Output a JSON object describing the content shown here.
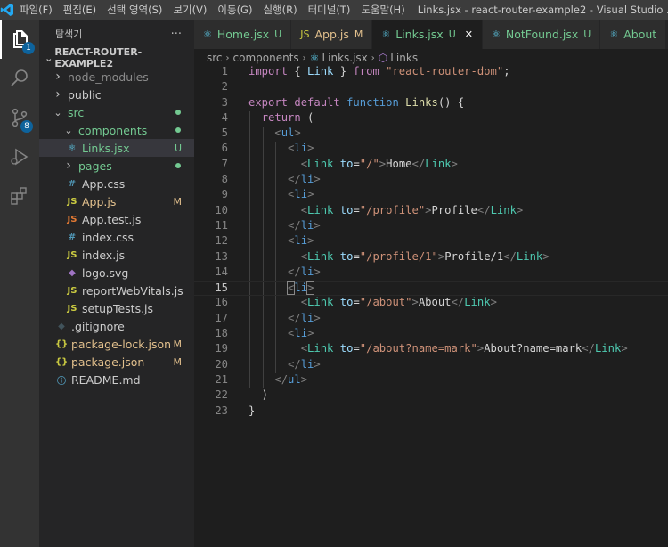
{
  "titlebar": {
    "menu": [
      "파일(F)",
      "편집(E)",
      "선택 영역(S)",
      "보기(V)",
      "이동(G)",
      "실행(R)",
      "터미널(T)",
      "도움말(H)"
    ],
    "title": "Links.jsx - react-router-example2 - Visual Studio ..."
  },
  "activity": {
    "explorer_badge": "1",
    "scm_badge": "8"
  },
  "sidebar": {
    "title": "탐색기",
    "more": "···",
    "project": "REACT-ROUTER-EXAMPLE2",
    "items": [
      {
        "name": "node_modules",
        "kind": "folder-closed",
        "color": "#8b8b8b",
        "badge": "",
        "dot": false
      },
      {
        "name": "public",
        "kind": "folder-closed",
        "color": "#cccccc",
        "badge": "",
        "dot": false
      },
      {
        "name": "src",
        "kind": "folder-open",
        "color": "#73c991",
        "badge": "",
        "dot": true
      },
      {
        "name": "components",
        "kind": "folder-open",
        "color": "#73c991",
        "badge": "",
        "dot": true
      },
      {
        "name": "Links.jsx",
        "kind": "file",
        "icon": "⚛",
        "icon_color": "#61dafb",
        "color": "#73c991",
        "badge": "U",
        "badge_color": "#73c991",
        "dot": false
      },
      {
        "name": "pages",
        "kind": "folder-closed",
        "color": "#73c991",
        "badge": "",
        "dot": true
      },
      {
        "name": "App.css",
        "kind": "file",
        "icon": "#",
        "icon_color": "#519aba",
        "color": "#cccccc",
        "badge": "",
        "dot": false
      },
      {
        "name": "App.js",
        "kind": "file",
        "icon": "JS",
        "icon_color": "#cbcb41",
        "color": "#e2c08d",
        "badge": "M",
        "badge_color": "#e2c08d",
        "dot": false
      },
      {
        "name": "App.test.js",
        "kind": "file",
        "icon": "JS",
        "icon_color": "#e37933",
        "color": "#cccccc",
        "badge": "",
        "dot": false
      },
      {
        "name": "index.css",
        "kind": "file",
        "icon": "#",
        "icon_color": "#519aba",
        "color": "#cccccc",
        "badge": "",
        "dot": false
      },
      {
        "name": "index.js",
        "kind": "file",
        "icon": "JS",
        "icon_color": "#cbcb41",
        "color": "#cccccc",
        "badge": "",
        "dot": false
      },
      {
        "name": "logo.svg",
        "kind": "file",
        "icon": "◆",
        "icon_color": "#a074c4",
        "color": "#cccccc",
        "badge": "",
        "dot": false
      },
      {
        "name": "reportWebVitals.js",
        "kind": "file",
        "icon": "JS",
        "icon_color": "#cbcb41",
        "color": "#cccccc",
        "badge": "",
        "dot": false
      },
      {
        "name": "setupTests.js",
        "kind": "file",
        "icon": "JS",
        "icon_color": "#cbcb41",
        "color": "#cccccc",
        "badge": "",
        "dot": false
      },
      {
        "name": ".gitignore",
        "kind": "file",
        "icon": "◆",
        "icon_color": "#41535b",
        "color": "#cccccc",
        "badge": "",
        "dot": false
      },
      {
        "name": "package-lock.json",
        "kind": "file",
        "icon": "{}",
        "icon_color": "#cbcb41",
        "color": "#e2c08d",
        "badge": "M",
        "badge_color": "#e2c08d",
        "dot": false
      },
      {
        "name": "package.json",
        "kind": "file",
        "icon": "{}",
        "icon_color": "#cbcb41",
        "color": "#e2c08d",
        "badge": "M",
        "badge_color": "#e2c08d",
        "dot": false
      },
      {
        "name": "README.md",
        "kind": "file",
        "icon": "ⓘ",
        "icon_color": "#519aba",
        "color": "#cccccc",
        "badge": "",
        "dot": false
      }
    ]
  },
  "tabs": [
    {
      "label": "Home.jsx",
      "icon": "⚛",
      "icon_color": "#61dafb",
      "status": "U",
      "color": "#73c991",
      "active": false
    },
    {
      "label": "App.js",
      "icon": "JS",
      "icon_color": "#cbcb41",
      "status": "M",
      "color": "#e2c08d",
      "active": false
    },
    {
      "label": "Links.jsx",
      "icon": "⚛",
      "icon_color": "#61dafb",
      "status": "U",
      "color": "#73c991",
      "active": true,
      "close": "✕"
    },
    {
      "label": "NotFound.jsx",
      "icon": "⚛",
      "icon_color": "#61dafb",
      "status": "U",
      "color": "#73c991",
      "active": false
    },
    {
      "label": "About",
      "icon": "⚛",
      "icon_color": "#61dafb",
      "status": "",
      "color": "#73c991",
      "active": false
    }
  ],
  "breadcrumb": [
    "src",
    "components",
    "Links.jsx",
    "Links"
  ],
  "editor": {
    "current_line": 15,
    "lines": [
      [
        [
          "kw",
          "import"
        ],
        [
          "tx",
          " { "
        ],
        [
          "id",
          "Link"
        ],
        [
          "tx",
          " } "
        ],
        [
          "kw",
          "from"
        ],
        [
          "tx",
          " "
        ],
        [
          "str",
          "\"react-router-dom\""
        ],
        [
          "tx",
          ";"
        ]
      ],
      [],
      [
        [
          "kw",
          "export"
        ],
        [
          "tx",
          " "
        ],
        [
          "kw",
          "default"
        ],
        [
          "tx",
          " "
        ],
        [
          "bl",
          "function"
        ],
        [
          "tx",
          " "
        ],
        [
          "fn",
          "Links"
        ],
        [
          "tx",
          "() {"
        ]
      ],
      [
        [
          "tx",
          "  "
        ],
        [
          "kw",
          "return"
        ],
        [
          "tx",
          " ("
        ]
      ],
      [
        [
          "tx",
          "    "
        ],
        [
          "tag",
          "<"
        ],
        [
          "tn",
          "ul"
        ],
        [
          "tag",
          ">"
        ]
      ],
      [
        [
          "tx",
          "      "
        ],
        [
          "tag",
          "<"
        ],
        [
          "tn",
          "li"
        ],
        [
          "tag",
          ">"
        ]
      ],
      [
        [
          "tx",
          "        "
        ],
        [
          "tag",
          "<"
        ],
        [
          "comp",
          "Link"
        ],
        [
          "tx",
          " "
        ],
        [
          "at",
          "to"
        ],
        [
          "tx",
          "="
        ],
        [
          "str",
          "\"/\""
        ],
        [
          "tag",
          ">"
        ],
        [
          "tx",
          "Home"
        ],
        [
          "tag",
          "</"
        ],
        [
          "comp",
          "Link"
        ],
        [
          "tag",
          ">"
        ]
      ],
      [
        [
          "tx",
          "      "
        ],
        [
          "tag",
          "</"
        ],
        [
          "tn",
          "li"
        ],
        [
          "tag",
          ">"
        ]
      ],
      [
        [
          "tx",
          "      "
        ],
        [
          "tag",
          "<"
        ],
        [
          "tn",
          "li"
        ],
        [
          "tag",
          ">"
        ]
      ],
      [
        [
          "tx",
          "        "
        ],
        [
          "tag",
          "<"
        ],
        [
          "comp",
          "Link"
        ],
        [
          "tx",
          " "
        ],
        [
          "at",
          "to"
        ],
        [
          "tx",
          "="
        ],
        [
          "str",
          "\"/profile\""
        ],
        [
          "tag",
          ">"
        ],
        [
          "tx",
          "Profile"
        ],
        [
          "tag",
          "</"
        ],
        [
          "comp",
          "Link"
        ],
        [
          "tag",
          ">"
        ]
      ],
      [
        [
          "tx",
          "      "
        ],
        [
          "tag",
          "</"
        ],
        [
          "tn",
          "li"
        ],
        [
          "tag",
          ">"
        ]
      ],
      [
        [
          "tx",
          "      "
        ],
        [
          "tag",
          "<"
        ],
        [
          "tn",
          "li"
        ],
        [
          "tag",
          ">"
        ]
      ],
      [
        [
          "tx",
          "        "
        ],
        [
          "tag",
          "<"
        ],
        [
          "comp",
          "Link"
        ],
        [
          "tx",
          " "
        ],
        [
          "at",
          "to"
        ],
        [
          "tx",
          "="
        ],
        [
          "str",
          "\"/profile/1\""
        ],
        [
          "tag",
          ">"
        ],
        [
          "tx",
          "Profile/1"
        ],
        [
          "tag",
          "</"
        ],
        [
          "comp",
          "Link"
        ],
        [
          "tag",
          ">"
        ]
      ],
      [
        [
          "tx",
          "      "
        ],
        [
          "tag",
          "</"
        ],
        [
          "tn",
          "li"
        ],
        [
          "tag",
          ">"
        ]
      ],
      [
        [
          "tx",
          "      "
        ],
        [
          "tag",
          "<"
        ],
        [
          "tn",
          "li"
        ],
        [
          "tag",
          ">"
        ]
      ],
      [
        [
          "tx",
          "        "
        ],
        [
          "tag",
          "<"
        ],
        [
          "comp",
          "Link"
        ],
        [
          "tx",
          " "
        ],
        [
          "at",
          "to"
        ],
        [
          "tx",
          "="
        ],
        [
          "str",
          "\"/about\""
        ],
        [
          "tag",
          ">"
        ],
        [
          "tx",
          "About"
        ],
        [
          "tag",
          "</"
        ],
        [
          "comp",
          "Link"
        ],
        [
          "tag",
          ">"
        ]
      ],
      [
        [
          "tx",
          "      "
        ],
        [
          "tag",
          "</"
        ],
        [
          "tn",
          "li"
        ],
        [
          "tag",
          ">"
        ]
      ],
      [
        [
          "tx",
          "      "
        ],
        [
          "tag",
          "<"
        ],
        [
          "tn",
          "li"
        ],
        [
          "tag",
          ">"
        ]
      ],
      [
        [
          "tx",
          "        "
        ],
        [
          "tag",
          "<"
        ],
        [
          "comp",
          "Link"
        ],
        [
          "tx",
          " "
        ],
        [
          "at",
          "to"
        ],
        [
          "tx",
          "="
        ],
        [
          "str",
          "\"/about?name=mark\""
        ],
        [
          "tag",
          ">"
        ],
        [
          "tx",
          "About?name=mark"
        ],
        [
          "tag",
          "</"
        ],
        [
          "comp",
          "Link"
        ],
        [
          "tag",
          ">"
        ]
      ],
      [
        [
          "tx",
          "      "
        ],
        [
          "tag",
          "</"
        ],
        [
          "tn",
          "li"
        ],
        [
          "tag",
          ">"
        ]
      ],
      [
        [
          "tx",
          "    "
        ],
        [
          "tag",
          "</"
        ],
        [
          "tn",
          "ul"
        ],
        [
          "tag",
          ">"
        ]
      ],
      [
        [
          "tx",
          "  )"
        ]
      ],
      [
        [
          "tx",
          "}"
        ]
      ]
    ]
  }
}
